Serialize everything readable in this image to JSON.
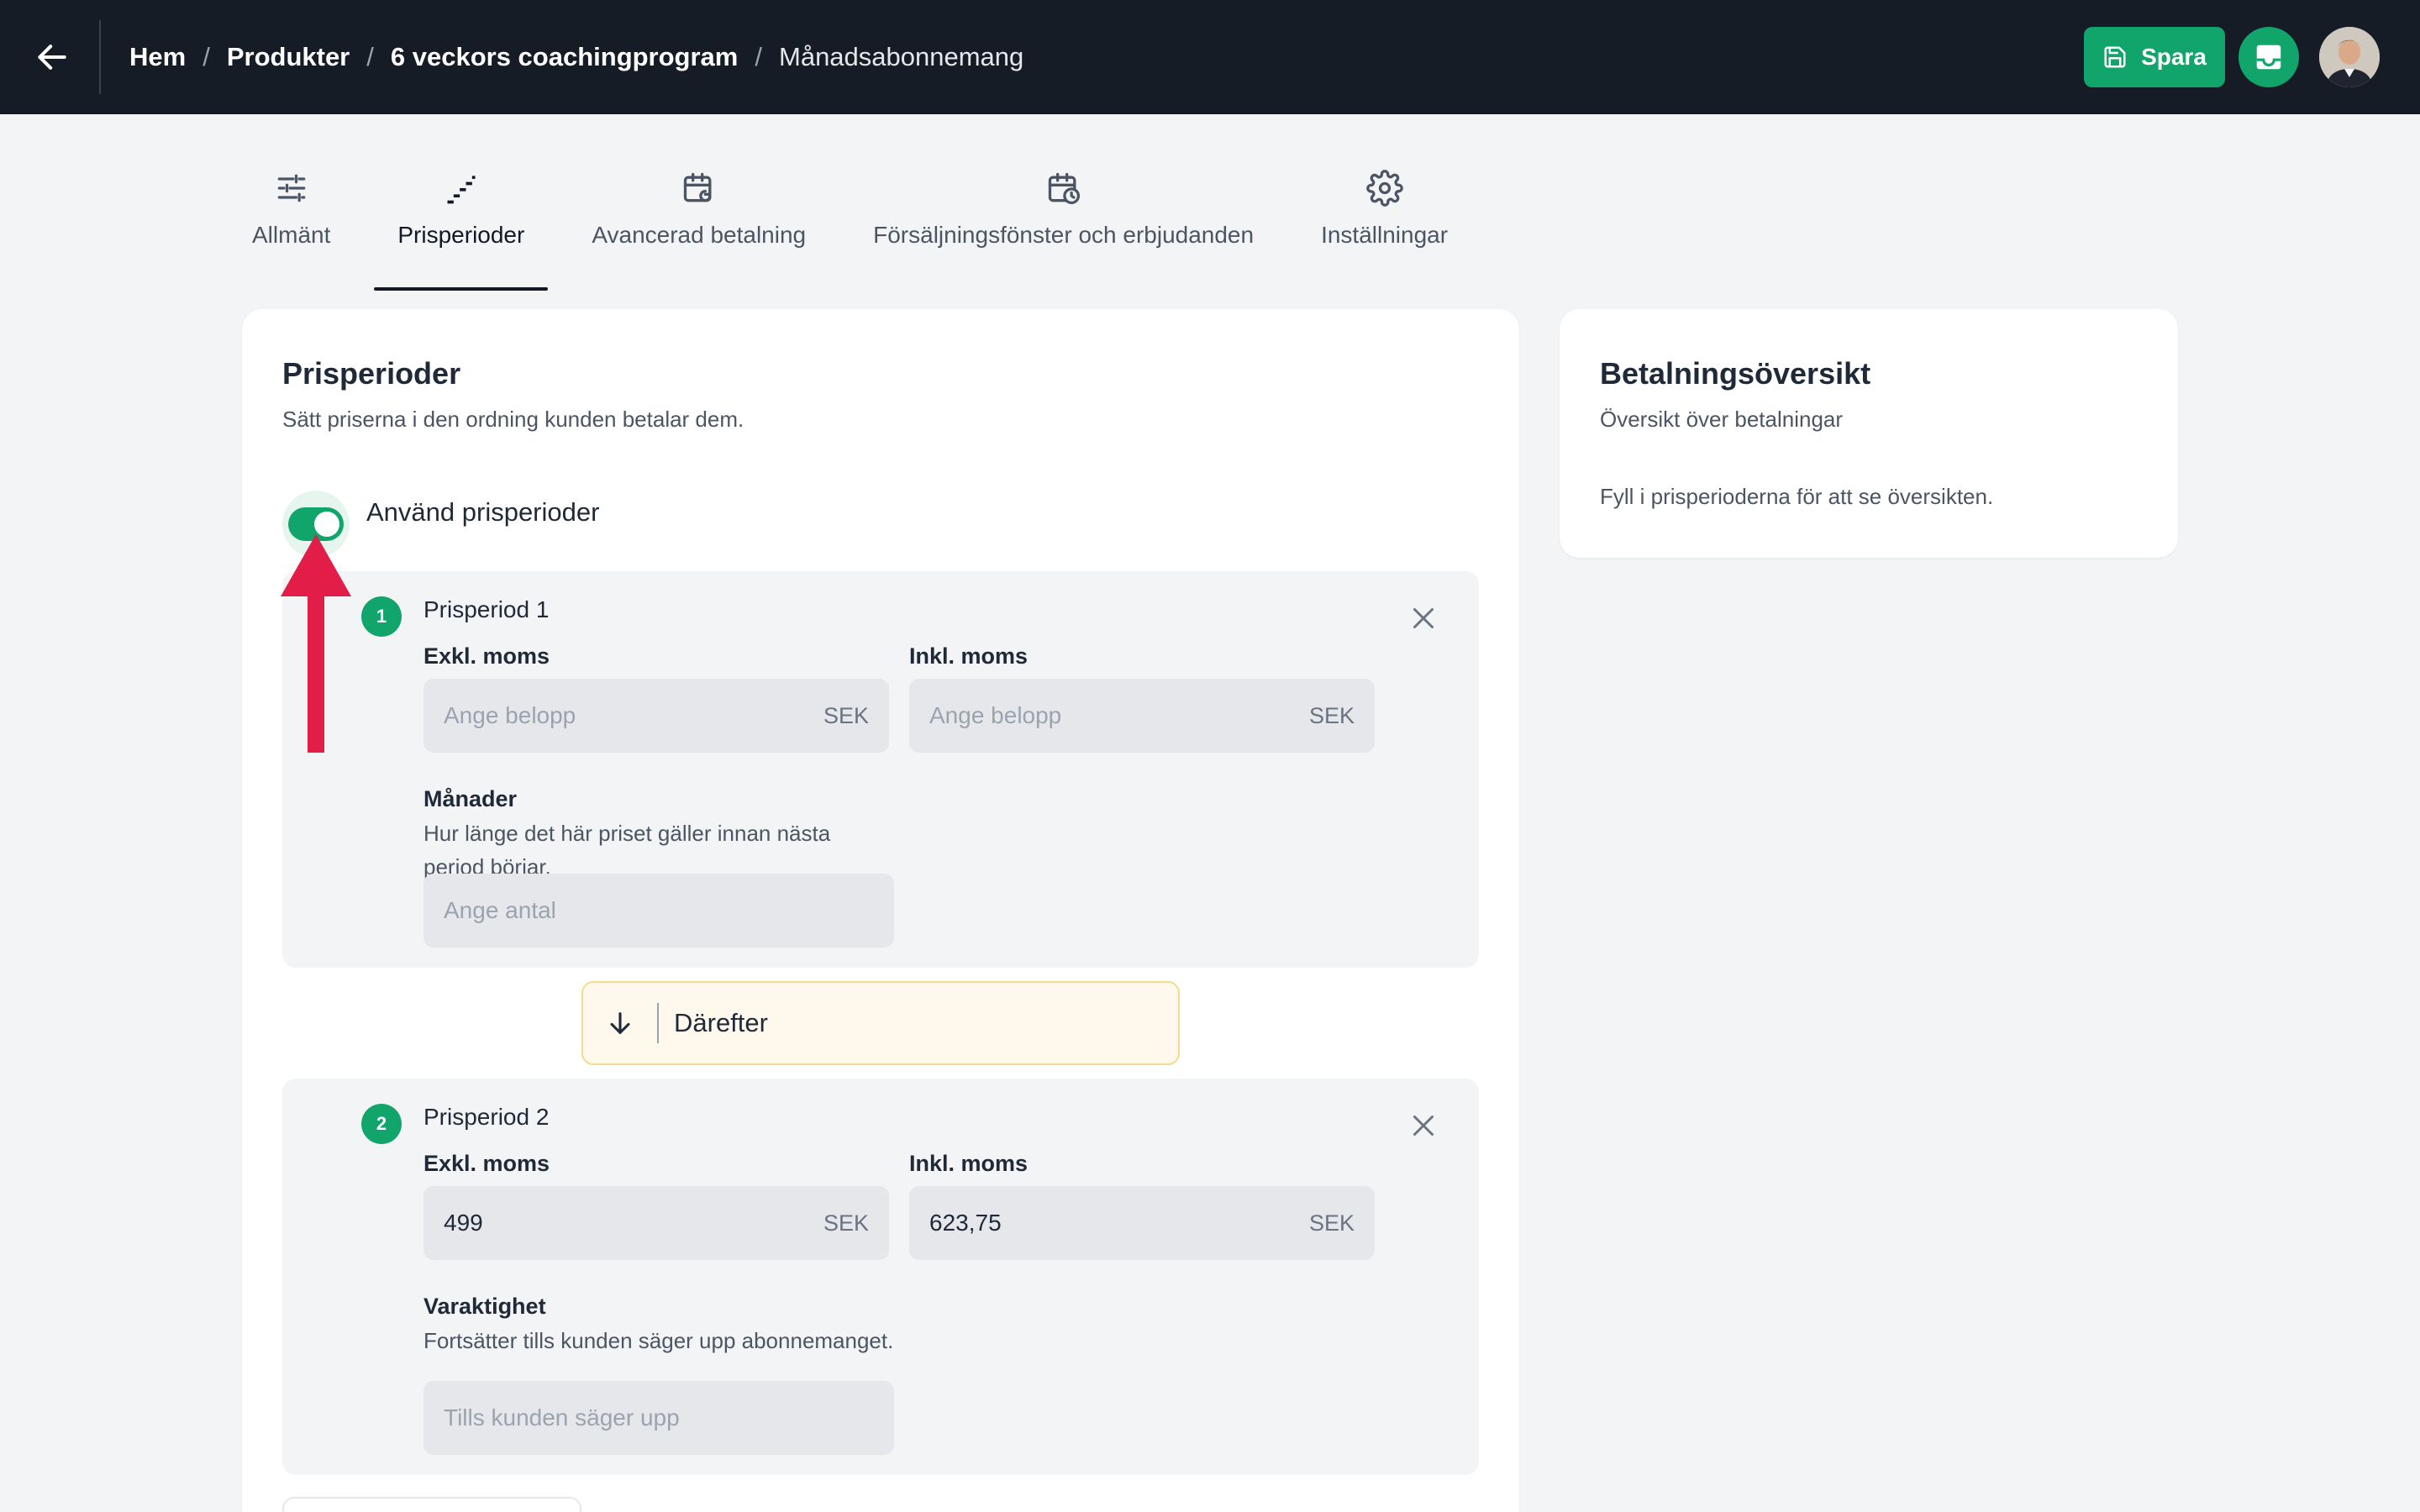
{
  "header": {
    "breadcrumb": [
      {
        "label": "Hem"
      },
      {
        "label": "Produkter"
      },
      {
        "label": "6 veckors coachingprogram"
      }
    ],
    "breadcrumb_separator": "/",
    "current_page": "Månadsabonnemang",
    "save_label": "Spara",
    "accent_color": "#12a56b",
    "bar_color": "#161c26"
  },
  "tabs": [
    {
      "label": "Allmänt",
      "icon": "sliders-icon"
    },
    {
      "label": "Prisperioder",
      "icon": "stairs-icon",
      "active": true
    },
    {
      "label": "Avancerad betalning",
      "icon": "calendar-refresh-icon"
    },
    {
      "label": "Försäljningsfönster och erbjudanden",
      "icon": "calendar-clock-icon"
    },
    {
      "label": "Inställningar",
      "icon": "gear-icon"
    }
  ],
  "main": {
    "title": "Prisperioder",
    "subtitle": "Sätt priserna i den ordning kunden betalar dem.",
    "toggle_label": "Använd prisperioder",
    "toggle_on": true,
    "periods": [
      {
        "number": "1",
        "title": "Prisperiod 1",
        "excl_label": "Exkl. moms",
        "incl_label": "Inkl. moms",
        "excl_placeholder": "Ange belopp",
        "incl_placeholder": "Ange belopp",
        "currency": "SEK",
        "duration_label": "Månader",
        "duration_help": "Hur länge det här priset gäller innan nästa period börjar.",
        "duration_placeholder": "Ange antal"
      },
      {
        "number": "2",
        "title": "Prisperiod 2",
        "excl_label": "Exkl. moms",
        "incl_label": "Inkl. moms",
        "excl_value": "499",
        "incl_value": "623,75",
        "currency": "SEK",
        "duration_label": "Varaktighet",
        "duration_help": "Fortsätter tills kunden säger upp abonnemanget.",
        "duration_placeholder": "Tills kunden säger upp"
      }
    ],
    "thereafter_label": "Därefter"
  },
  "side": {
    "title": "Betalningsöversikt",
    "subtitle": "Översikt över betalningar",
    "empty_text": "Fyll i prisperioderna för att se översikten."
  }
}
